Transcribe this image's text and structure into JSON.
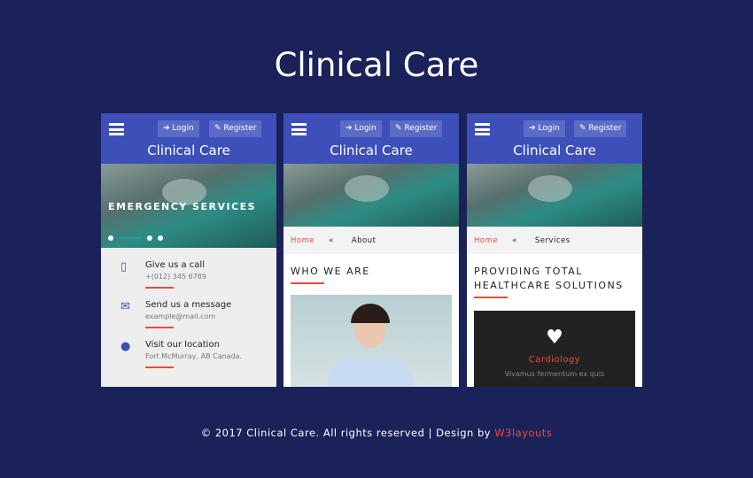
{
  "title": "Clinical Care",
  "header": {
    "login": "➔ Login",
    "register": "✎ Register",
    "brand": "Clinical Care"
  },
  "phone1": {
    "hero": "EMERGENCY SERVICES",
    "contacts": [
      {
        "icon": "phone-icon",
        "title": "Give us a call",
        "detail": "+(012) 345 6789"
      },
      {
        "icon": "mail-icon",
        "title": "Send us a message",
        "detail": "example@mail.com"
      },
      {
        "icon": "location-pin-icon",
        "title": "Visit our location",
        "detail": "Fort McMurray, AB Canada."
      }
    ]
  },
  "phone2": {
    "crumb_home": "Home",
    "crumb_sep": "«",
    "crumb_current": "About",
    "heading": "WHO WE ARE"
  },
  "phone3": {
    "crumb_home": "Home",
    "crumb_sep": "«",
    "crumb_current": "Services",
    "heading": "PROVIDING TOTAL HEALTHCARE SOLUTIONS",
    "card_title": "Cardiology",
    "card_text": "Vivamus fermentum ex quis"
  },
  "footer": {
    "text": "© 2017 Clinical Care. All rights reserved | Design by ",
    "link": "W3layouts"
  },
  "colors": {
    "background": "#1b2159",
    "header": "#3d4fb8",
    "accent": "#e74c3c"
  }
}
